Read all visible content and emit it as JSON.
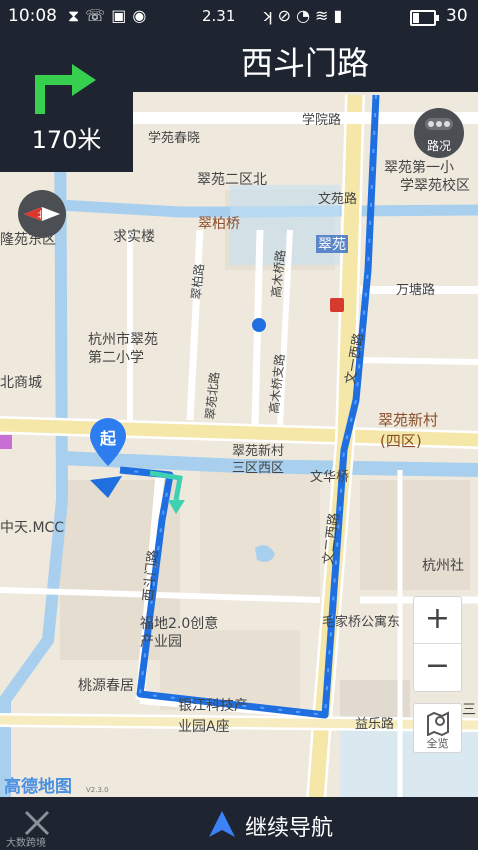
{
  "status_bar": {
    "time": "10:08",
    "left_icons": [
      "payment-icon",
      "missed-call-icon",
      "gallery-icon",
      "wechat-icon"
    ],
    "network_speed": "2.31",
    "right_icons": [
      "nfc-icon",
      "mute-icon",
      "alarm-icon",
      "wifi-icon",
      "signal-4g-icon"
    ],
    "battery_level": 30,
    "battery_text": "30"
  },
  "navigation": {
    "street_name": "西斗门路",
    "turn_icon": "turn-right-arrow-icon",
    "distance": "170米"
  },
  "map": {
    "traffic_button_label": "路况",
    "compass_icon": "compass-icon",
    "logo": "高德地图",
    "version_text": "V2.3.0",
    "labels": [
      {
        "id": "l1",
        "text": "学院路"
      },
      {
        "id": "l2",
        "text": "学苑春晓"
      },
      {
        "id": "l3",
        "text": "翠苑二区北"
      },
      {
        "id": "l4",
        "text": "翠苑第一小"
      },
      {
        "id": "l5",
        "text": "学翠苑校区"
      },
      {
        "id": "l6",
        "text": "文苑路"
      },
      {
        "id": "l7",
        "text": "翠柏桥"
      },
      {
        "id": "l8",
        "text": "求实楼"
      },
      {
        "id": "l9",
        "text": "隆苑东区"
      },
      {
        "id": "l10",
        "text": "翠苑"
      },
      {
        "id": "l11",
        "text": "万塘路"
      },
      {
        "id": "l12",
        "text": "翠柏路"
      },
      {
        "id": "l13",
        "text": "高木桥路"
      },
      {
        "id": "l14",
        "text": "杭州市翠苑"
      },
      {
        "id": "l15",
        "text": "第二小学"
      },
      {
        "id": "l16",
        "text": "文一西路"
      },
      {
        "id": "l17",
        "text": "北商城"
      },
      {
        "id": "l18",
        "text": "翠苑北路"
      },
      {
        "id": "l19",
        "text": "高木桥支路"
      },
      {
        "id": "l20",
        "text": "翠苑新村"
      },
      {
        "id": "l21",
        "text": "(四区)"
      },
      {
        "id": "l22",
        "text": "翠苑新村"
      },
      {
        "id": "l23",
        "text": "三区西区"
      },
      {
        "id": "l24",
        "text": "文华桥"
      },
      {
        "id": "l25",
        "text": "中天.MCC"
      },
      {
        "id": "l26",
        "text": "文二西路"
      },
      {
        "id": "l27",
        "text": "杭州社"
      },
      {
        "id": "l28",
        "text": "西斗门路"
      },
      {
        "id": "l29",
        "text": "福地2.0创意"
      },
      {
        "id": "l30",
        "text": "产业园"
      },
      {
        "id": "l31",
        "text": "毛家桥公寓东"
      },
      {
        "id": "l32",
        "text": "桃源春居"
      },
      {
        "id": "l33",
        "text": "银江科技产"
      },
      {
        "id": "l34",
        "text": "业园A座"
      },
      {
        "id": "l35",
        "text": "益乐路"
      },
      {
        "id": "l36",
        "text": "三"
      }
    ],
    "zoom_in_label": "+",
    "zoom_out_label": "−",
    "overview_label": "全览",
    "start_marker_label": "起"
  },
  "bottom_bar": {
    "close_icon": "close-icon",
    "continue_label": "继续导航",
    "continue_icon": "navigation-arrow-icon",
    "watermark": "大数跨境"
  }
}
